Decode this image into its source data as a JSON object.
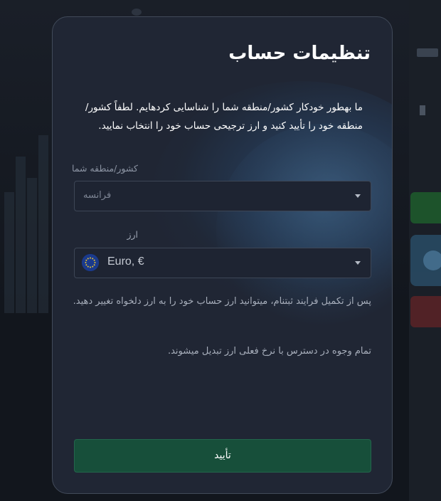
{
  "modal": {
    "title": "تنظیمات حساب",
    "description": "ما بهطور خودکار کشور/منطقه شما را شناسایی کردهایم. لطفاً کشور/منطقه خود را تأیید کنید و ارز ترجیحی حساب خود را انتخاب نمایید.",
    "country": {
      "label": "کشور/منطقه شما",
      "selected": "فرانسه"
    },
    "currency": {
      "label": "ارز",
      "selected": "Euro, €",
      "flag_icon": "eu-flag-icon"
    },
    "note_1": "پس از تکمیل فرایند ثبتنام، میتوانید ارز حساب خود را به ارز دلخواه تغییر دهید.",
    "note_2": "تمام وجوه در دسترس با نرخ فعلی ارز تبدیل میشوند.",
    "confirm_label": "تأیید"
  },
  "colors": {
    "modal_bg": "#202634",
    "confirm_bg": "#174f3a",
    "eu_blue": "#1a3a8c",
    "eu_star": "#f5cc2a"
  }
}
